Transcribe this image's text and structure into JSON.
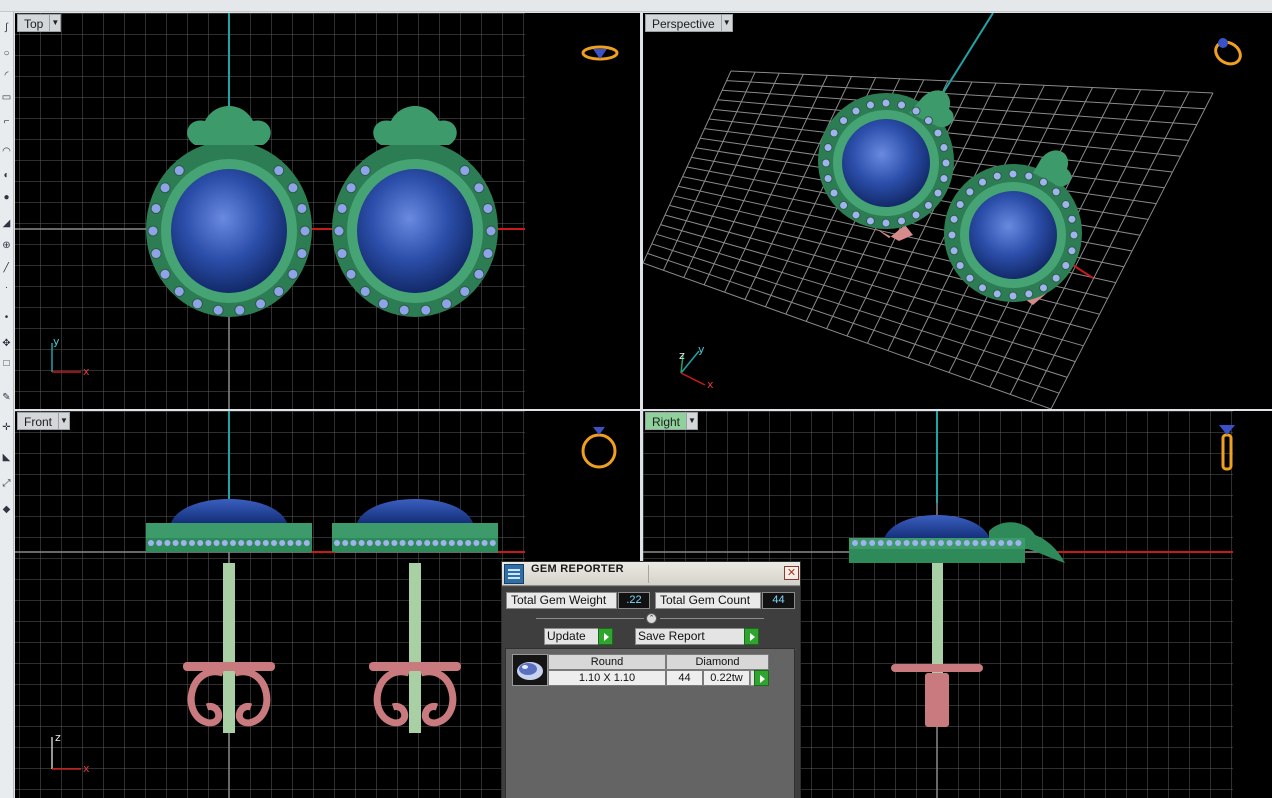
{
  "viewports": {
    "top": {
      "label": "Top",
      "axis_a": "y",
      "axis_b": "x"
    },
    "perspective": {
      "label": "Perspective",
      "axis_a": "z",
      "axis_b": "y",
      "axis_c": "x"
    },
    "front": {
      "label": "Front",
      "axis_a": "z",
      "axis_b": "x"
    },
    "right": {
      "label": "Right",
      "active": true
    }
  },
  "gem_reporter": {
    "title": "GEM REPORTER",
    "close_glyph": "✕",
    "total_weight_label": "Total Gem Weight",
    "total_weight_value": ".22",
    "total_count_label": "Total Gem Count",
    "total_count_value": "44",
    "collapse_glyph": "⌃",
    "update_label": "Update",
    "save_report_label": "Save Report",
    "gem_row": {
      "shape": "Round",
      "material": "Diamond",
      "size": "1.10 X 1.10",
      "count": "44",
      "weight": "0.22tw"
    }
  },
  "colors": {
    "viewport_bg": "#000000",
    "grid": "#6a6a6a",
    "x_axis": "#c81a1a",
    "y_axis": "#1fa4a8",
    "metal_green": "#2f8a5a",
    "gem_blue": "#2b4fa8",
    "post_green": "#a9cfa4",
    "back_pink": "#c97a7e",
    "active_label": "#8fd19a",
    "widget_orange": "#f0a020"
  },
  "icons": [
    "ring-widget-icon",
    "gem-reporter-icon",
    "close-icon",
    "collapse-icon",
    "go-arrow-icon"
  ]
}
